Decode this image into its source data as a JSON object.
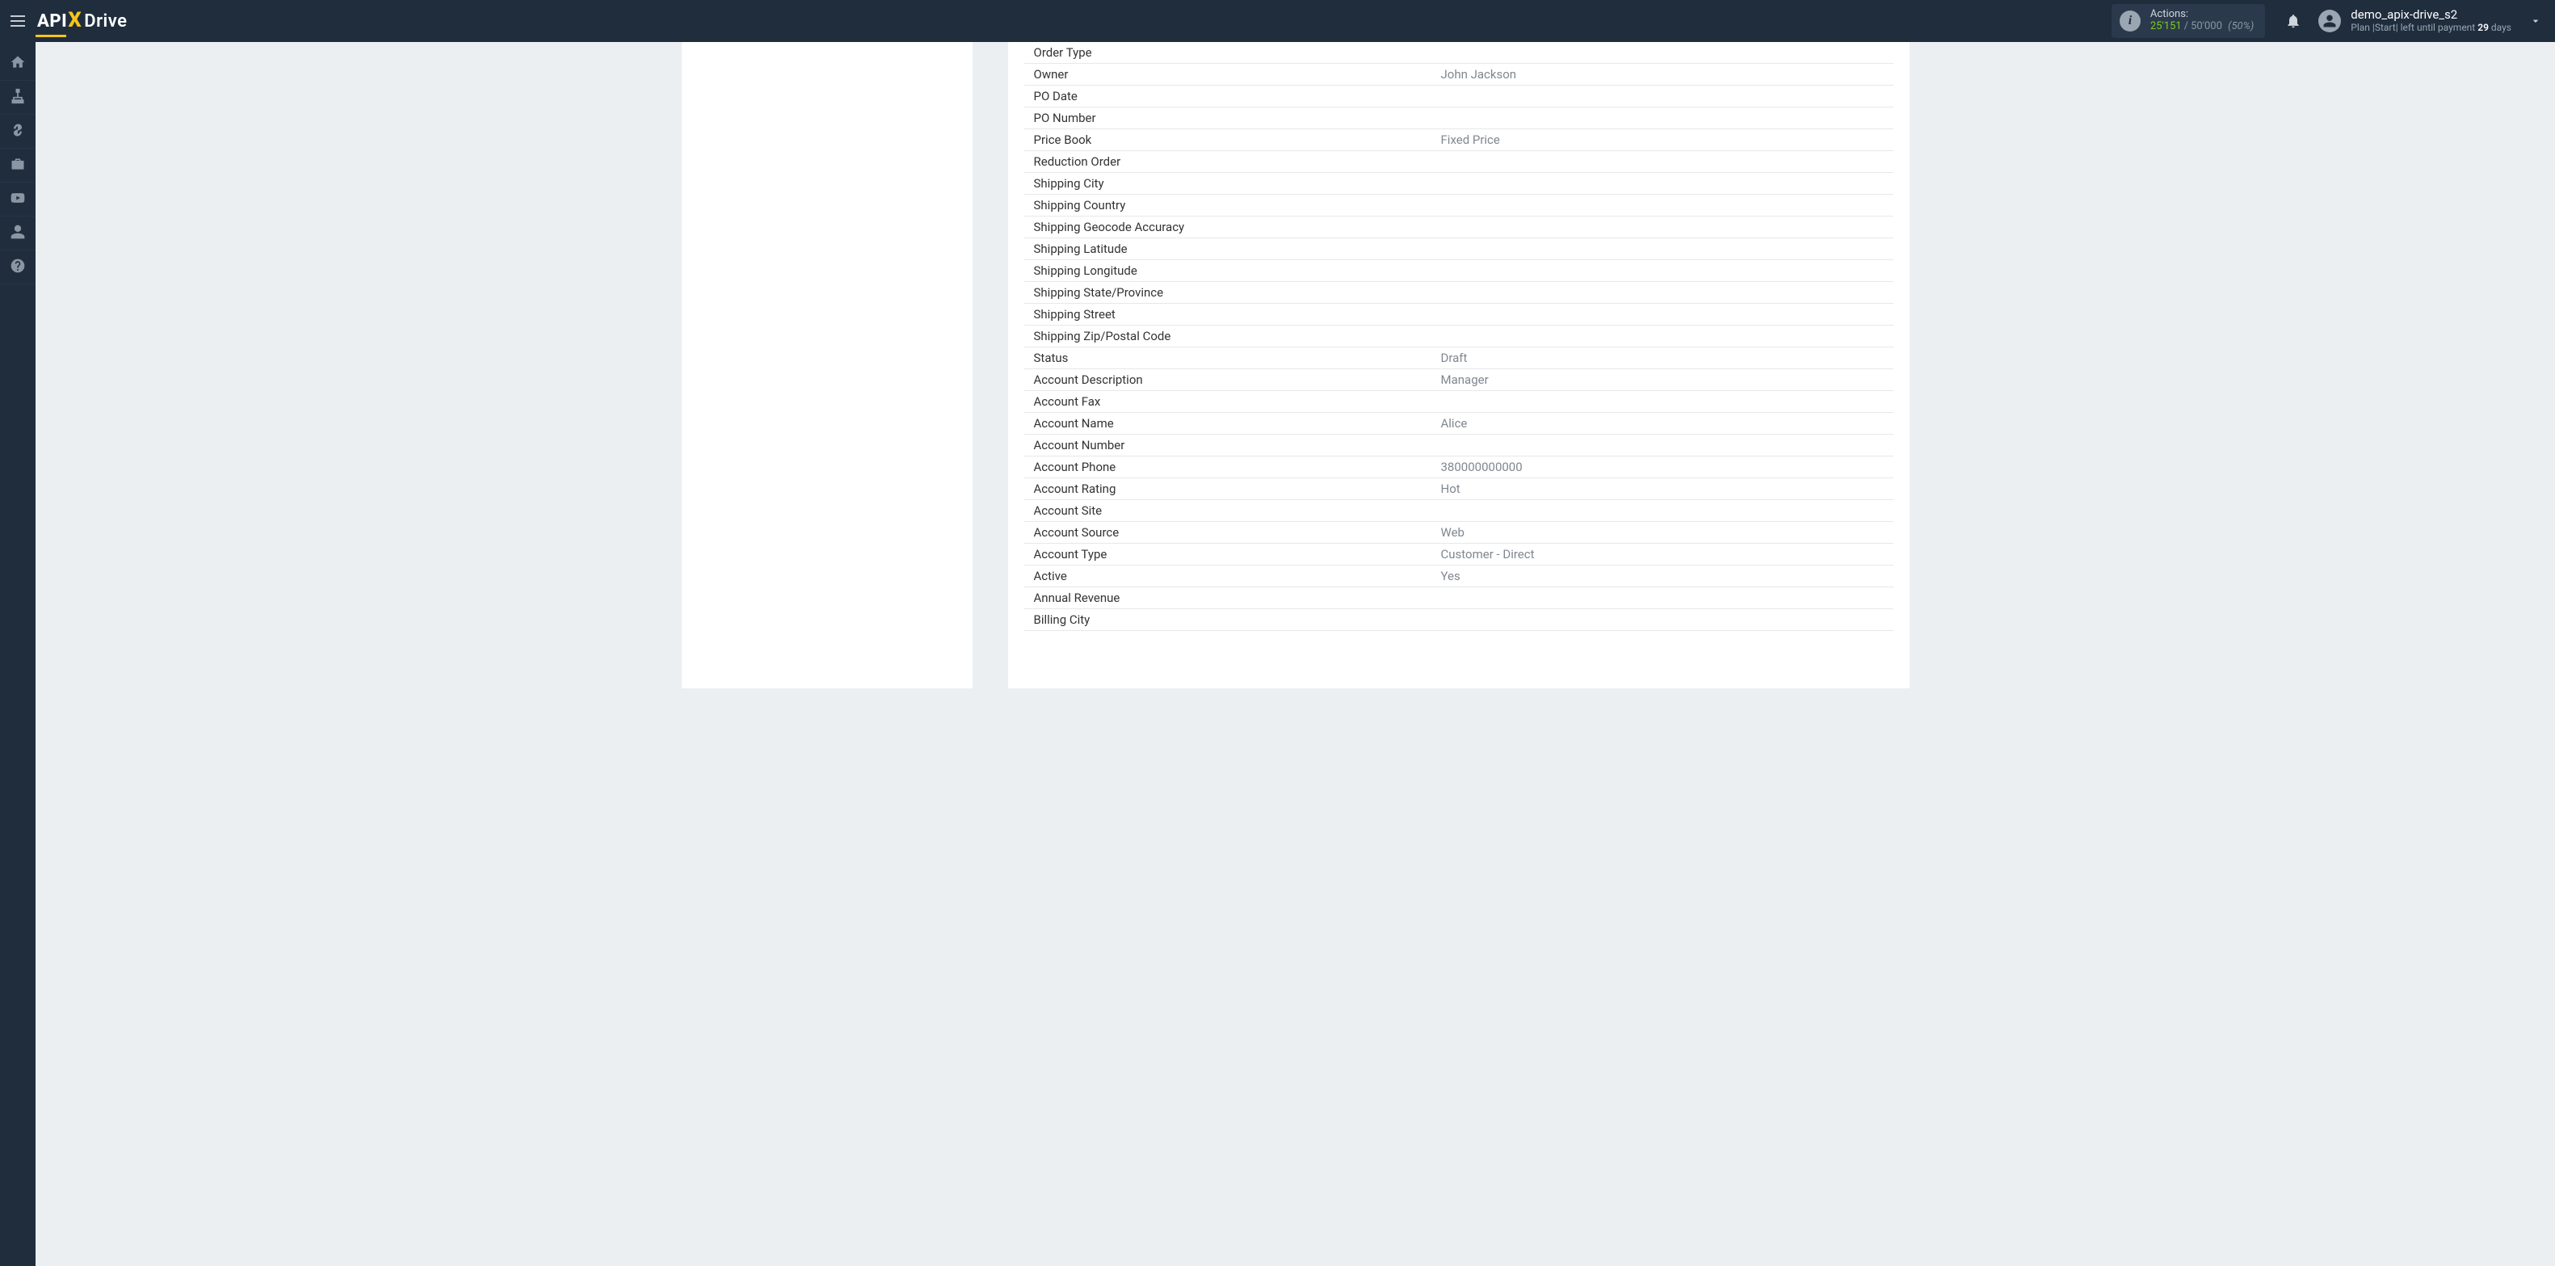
{
  "header": {
    "logo": {
      "part1": "API",
      "part2": "X",
      "part3": "Drive"
    },
    "actions": {
      "title": "Actions:",
      "used": "25'151",
      "limit": "50'000",
      "percent": "(50%)"
    },
    "user": {
      "name": "demo_apix-drive_s2",
      "plan_prefix": "Plan |Start| left until payment ",
      "plan_days_num": "29",
      "plan_days_word": " days"
    }
  },
  "sidebar": {
    "items": [
      {
        "name": "home",
        "icon": "home"
      },
      {
        "name": "connections",
        "icon": "sitemap"
      },
      {
        "name": "billing",
        "icon": "dollar"
      },
      {
        "name": "projects",
        "icon": "briefcase"
      },
      {
        "name": "videos",
        "icon": "youtube"
      },
      {
        "name": "account",
        "icon": "user"
      },
      {
        "name": "help",
        "icon": "question"
      }
    ]
  },
  "fields": [
    {
      "label": "Order Type",
      "value": ""
    },
    {
      "label": "Owner",
      "value": "John Jackson"
    },
    {
      "label": "PO Date",
      "value": ""
    },
    {
      "label": "PO Number",
      "value": ""
    },
    {
      "label": "Price Book",
      "value": "Fixed Price"
    },
    {
      "label": "Reduction Order",
      "value": ""
    },
    {
      "label": "Shipping City",
      "value": ""
    },
    {
      "label": "Shipping Country",
      "value": ""
    },
    {
      "label": "Shipping Geocode Accuracy",
      "value": ""
    },
    {
      "label": "Shipping Latitude",
      "value": ""
    },
    {
      "label": "Shipping Longitude",
      "value": ""
    },
    {
      "label": "Shipping State/Province",
      "value": ""
    },
    {
      "label": "Shipping Street",
      "value": ""
    },
    {
      "label": "Shipping Zip/Postal Code",
      "value": ""
    },
    {
      "label": "Status",
      "value": "Draft"
    },
    {
      "label": "Account Description",
      "value": "Manager"
    },
    {
      "label": "Account Fax",
      "value": ""
    },
    {
      "label": "Account Name",
      "value": "Alice"
    },
    {
      "label": "Account Number",
      "value": ""
    },
    {
      "label": "Account Phone",
      "value": "380000000000"
    },
    {
      "label": "Account Rating",
      "value": "Hot"
    },
    {
      "label": "Account Site",
      "value": ""
    },
    {
      "label": "Account Source",
      "value": "Web"
    },
    {
      "label": "Account Type",
      "value": "Customer - Direct"
    },
    {
      "label": "Active",
      "value": "Yes"
    },
    {
      "label": "Annual Revenue",
      "value": ""
    },
    {
      "label": "Billing City",
      "value": ""
    }
  ]
}
